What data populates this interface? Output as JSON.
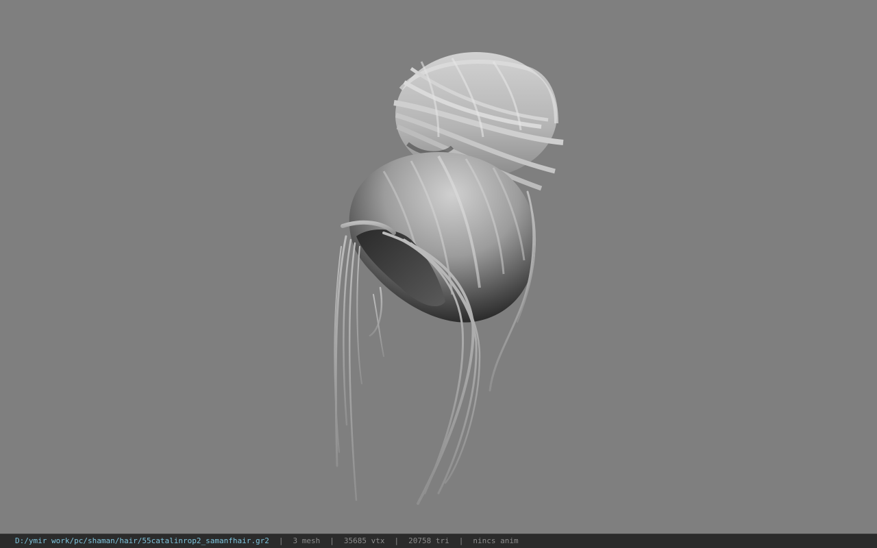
{
  "viewport": {
    "model_name": "hair-bun-model",
    "background_color": "#7f7f7f"
  },
  "status_bar": {
    "file_path": "D:/ymir work/pc/shaman/hair/55catalinrop2_samanfhair.gr2",
    "separator": "|",
    "mesh_count": "3 mesh",
    "vertex_count": "35685 vtx",
    "triangle_count": "20758 tri",
    "anim_status": "nincs anim",
    "path_color": "#7fc4dc",
    "text_color": "#8c8c8c"
  }
}
